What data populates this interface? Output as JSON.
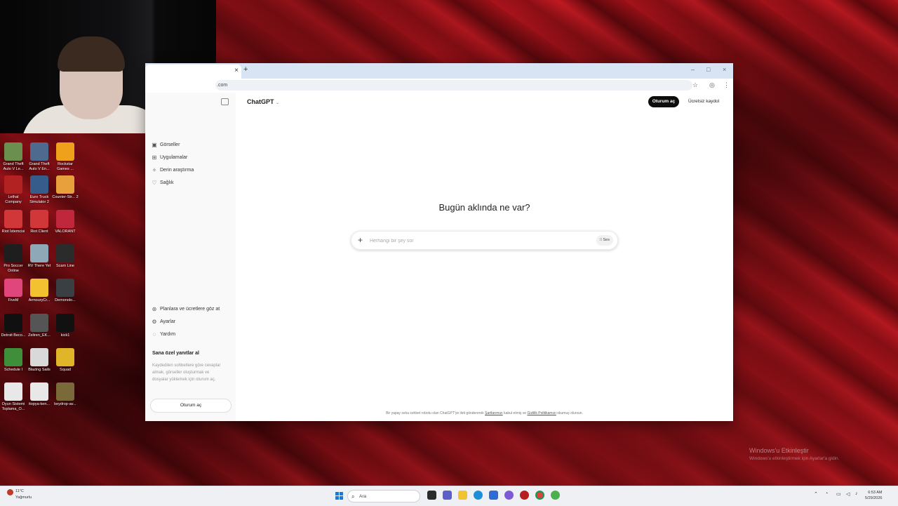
{
  "browser": {
    "tab_close": "×",
    "new_tab": "+",
    "window_controls": [
      "–",
      "□",
      "×"
    ],
    "url": ".com",
    "bookmark_icon": "star-icon",
    "profile_icon": "profile-icon",
    "menu_icon": "kebab-menu-icon"
  },
  "sidebar": {
    "items": [
      {
        "label": "Görseller",
        "icon": "image-icon"
      },
      {
        "label": "Uygulamalar",
        "icon": "apps-icon"
      },
      {
        "label": "Derin araştırma",
        "icon": "telescope-icon"
      },
      {
        "label": "Sağlık",
        "icon": "heart-icon"
      }
    ],
    "bottom_items": [
      {
        "label": "Planlara ve ücretlere göz at",
        "icon": "plans-icon"
      },
      {
        "label": "Ayarlar",
        "icon": "gear-icon"
      },
      {
        "label": "Yardım",
        "icon": "help-icon"
      }
    ],
    "promo_title": "Sana özel yanıtlar al",
    "promo_text": "Kaydedilen sohbetlere göre cevaplar almak, görseller oluşturmak ve dosyalar yüklemek için oturum aç.",
    "login_label": "Oturum aç"
  },
  "main": {
    "model_label": "ChatGPT",
    "login_button": "Oturum aç",
    "signup_button": "Ücretsiz kaydol",
    "heading": "Bugün aklında ne var?",
    "composer_placeholder": "Herhangi bir şey sor",
    "voice_label": "Ses",
    "footer_pre": "Bir yapay zeka sohbet robotu olan ChatGPT'ye ileti göndererek ",
    "footer_terms": "Şartlarımızı",
    "footer_mid": " kabul etmiş ve ",
    "footer_privacy": "Gizlilik Politikamızı",
    "footer_post": " okumuş olursun."
  },
  "desktop_icons": [
    {
      "label": "Grand Theft Auto V Le...",
      "color": "#6b8f4e"
    },
    {
      "label": "Grand Theft Auto V En...",
      "color": "#4e6b8f"
    },
    {
      "label": "Rockstar Games ...",
      "color": "#f0a11b"
    },
    {
      "label": "Lethal Company",
      "color": "#b22222"
    },
    {
      "label": "Euro Truck Simulator 2",
      "color": "#355c8a"
    },
    {
      "label": "Counter-Str... 2",
      "color": "#e8a03c"
    },
    {
      "label": "Riot İstemcisi",
      "color": "#d13639"
    },
    {
      "label": "Riot Client",
      "color": "#d13639"
    },
    {
      "label": "VALORANT",
      "color": "#c0263c"
    },
    {
      "label": "Pro Soccer Online",
      "color": "#1e1e1e"
    },
    {
      "label": "RV There Yet",
      "color": "#8fa8b8"
    },
    {
      "label": "Scam Line",
      "color": "#2b2b2b"
    },
    {
      "label": "FiveM",
      "color": "#e0457b"
    },
    {
      "label": "ArmouryCr...",
      "color": "#f2c230"
    },
    {
      "label": "Demonolo...",
      "color": "#3a3f44"
    },
    {
      "label": "Detroit Beco...",
      "color": "#101010"
    },
    {
      "label": "Zeliren_EK...",
      "color": "#555555"
    },
    {
      "label": "kick1",
      "color": "#111111"
    },
    {
      "label": "Schedule I",
      "color": "#3f8f3a"
    },
    {
      "label": "Blazing Sails",
      "color": "#d9d9d9"
    },
    {
      "label": "Squad",
      "color": "#e0b52a"
    },
    {
      "label": "Oyun Sistemi Toplama_O...",
      "color": "#e8e8e8"
    },
    {
      "label": "itopya-ken...",
      "color": "#e8e8e8"
    },
    {
      "label": "keydrop-av...",
      "color": "#7a6a3a"
    }
  ],
  "watermark": {
    "title": "Windows'u Etkinleştir",
    "subtitle": "Windows'u etkinleştirmek için Ayarlar'a gidin."
  },
  "taskbar": {
    "weather_temp": "11°C",
    "weather_desc": "Yağmurlu",
    "search_placeholder": "Ara",
    "time": "6:53 AM",
    "date": "5/29/2026"
  }
}
